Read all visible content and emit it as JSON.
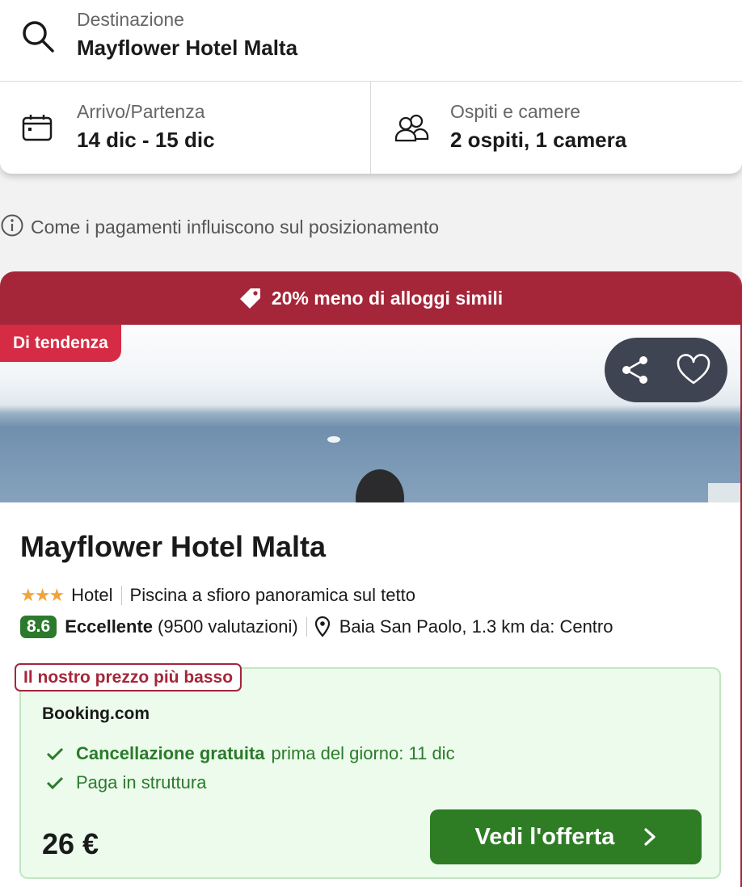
{
  "search": {
    "destination_label": "Destinazione",
    "destination_value": "Mayflower Hotel Malta",
    "dates_label": "Arrivo/Partenza",
    "dates_value": "14 dic - 15 dic",
    "guests_label": "Ospiti e camere",
    "guests_value": "2 ospiti, 1 camera",
    "icons": [
      "search-icon",
      "calendar-icon",
      "guests-icon"
    ]
  },
  "payments_note": "Come i pagamenti influiscono sul posizionamento",
  "hotel": {
    "deal_banner": "20% meno di alloggi simili",
    "trend_badge": "Di tendenza",
    "name": "Mayflower Hotel Malta",
    "stars": 3,
    "type": "Hotel",
    "highlight": "Piscina a sfioro panoramica sul tetto",
    "score": "8.6",
    "score_label": "Eccellente",
    "reviews": "(9500 valutazioni)",
    "location": "Baia San Paolo, 1.3 km da: Centro"
  },
  "offer": {
    "tag": "Il nostro prezzo più basso",
    "provider": "Booking.com",
    "free_cancel": "Cancellazione gratuita",
    "free_cancel_detail": "prima del giorno: 11 dic",
    "pay_at_property": "Paga in struttura",
    "price": "26 €",
    "cta": "Vedi l'offerta"
  },
  "colors": {
    "accent_red": "#a52639",
    "trend_red": "#d52b44",
    "green": "#2c7a2c",
    "offer_bg": "#ecfbec"
  }
}
